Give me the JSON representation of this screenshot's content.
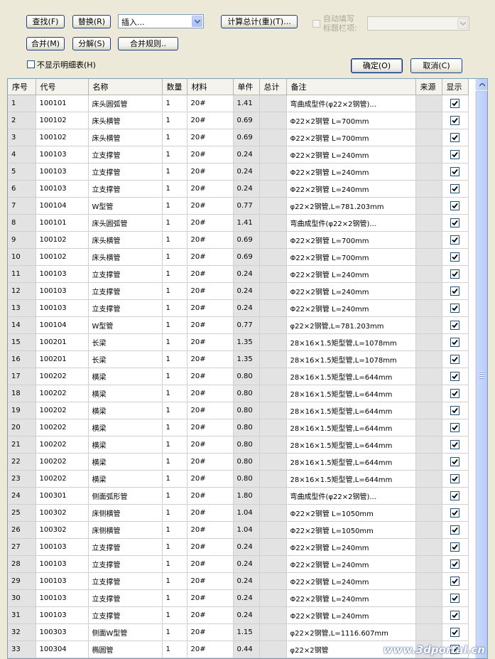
{
  "toolbar": {
    "find_label": "查找(F)",
    "replace_label": "替换(R)",
    "insert_value": "插入...",
    "calc_total_label": "计算总计(重)(T)...",
    "fill_title_label_line1": "自动填写",
    "fill_title_label_line2": "标题栏项:",
    "merge_label": "合并(M)",
    "split_label": "分解(S)",
    "merge_rules_label": "合并规则..",
    "hide_detail_label": "不显示明细表(H)",
    "ok_label": "确定(O)",
    "cancel_label": "取消(C)"
  },
  "table": {
    "headers": [
      "序号",
      "代号",
      "名称",
      "数量",
      "材料",
      "单件",
      "总计",
      "备注",
      "来源",
      "显示"
    ],
    "rows": [
      [
        "1",
        "100101",
        "床头圆弧管",
        "1",
        "20#",
        "1.41",
        "",
        "弯曲成型件(φ22×2钢管)...",
        "",
        true
      ],
      [
        "2",
        "100102",
        "床头横管",
        "1",
        "20#",
        "0.69",
        "",
        "Φ22×2钢管 L=700mm",
        "",
        true
      ],
      [
        "3",
        "100102",
        "床头横管",
        "1",
        "20#",
        "0.69",
        "",
        "Φ22×2钢管 L=700mm",
        "",
        true
      ],
      [
        "4",
        "100103",
        "立支撑管",
        "1",
        "20#",
        "0.24",
        "",
        "Φ22×2钢管 L=240mm",
        "",
        true
      ],
      [
        "5",
        "100103",
        "立支撑管",
        "1",
        "20#",
        "0.24",
        "",
        "Φ22×2钢管 L=240mm",
        "",
        true
      ],
      [
        "6",
        "100103",
        "立支撑管",
        "1",
        "20#",
        "0.24",
        "",
        "Φ22×2钢管 L=240mm",
        "",
        true
      ],
      [
        "7",
        "100104",
        "W型管",
        "1",
        "20#",
        "0.77",
        "",
        "φ22×2钢管,L=781.203mm",
        "",
        true
      ],
      [
        "8",
        "100101",
        "床头圆弧管",
        "1",
        "20#",
        "1.41",
        "",
        "弯曲成型件(φ22×2钢管)...",
        "",
        true
      ],
      [
        "9",
        "100102",
        "床头横管",
        "1",
        "20#",
        "0.69",
        "",
        "Φ22×2钢管 L=700mm",
        "",
        true
      ],
      [
        "10",
        "100102",
        "床头横管",
        "1",
        "20#",
        "0.69",
        "",
        "Φ22×2钢管 L=700mm",
        "",
        true
      ],
      [
        "11",
        "100103",
        "立支撑管",
        "1",
        "20#",
        "0.24",
        "",
        "Φ22×2钢管 L=240mm",
        "",
        true
      ],
      [
        "12",
        "100103",
        "立支撑管",
        "1",
        "20#",
        "0.24",
        "",
        "Φ22×2钢管 L=240mm",
        "",
        true
      ],
      [
        "13",
        "100103",
        "立支撑管",
        "1",
        "20#",
        "0.24",
        "",
        "Φ22×2钢管 L=240mm",
        "",
        true
      ],
      [
        "14",
        "100104",
        "W型管",
        "1",
        "20#",
        "0.77",
        "",
        "φ22×2钢管,L=781.203mm",
        "",
        true
      ],
      [
        "15",
        "100201",
        "长梁",
        "1",
        "20#",
        "1.35",
        "",
        "28×16×1.5矩型管,L=1078mm",
        "",
        true
      ],
      [
        "16",
        "100201",
        "长梁",
        "1",
        "20#",
        "1.35",
        "",
        "28×16×1.5矩型管,L=1078mm",
        "",
        true
      ],
      [
        "17",
        "100202",
        "横梁",
        "1",
        "20#",
        "0.80",
        "",
        "28×16×1.5矩型管,L=644mm",
        "",
        true
      ],
      [
        "18",
        "100202",
        "横梁",
        "1",
        "20#",
        "0.80",
        "",
        "28×16×1.5矩型管,L=644mm",
        "",
        true
      ],
      [
        "19",
        "100202",
        "横梁",
        "1",
        "20#",
        "0.80",
        "",
        "28×16×1.5矩型管,L=644mm",
        "",
        true
      ],
      [
        "20",
        "100202",
        "横梁",
        "1",
        "20#",
        "0.80",
        "",
        "28×16×1.5矩型管,L=644mm",
        "",
        true
      ],
      [
        "21",
        "100202",
        "横梁",
        "1",
        "20#",
        "0.80",
        "",
        "28×16×1.5矩型管,L=644mm",
        "",
        true
      ],
      [
        "22",
        "100202",
        "横梁",
        "1",
        "20#",
        "0.80",
        "",
        "28×16×1.5矩型管,L=644mm",
        "",
        true
      ],
      [
        "23",
        "100202",
        "横梁",
        "1",
        "20#",
        "0.80",
        "",
        "28×16×1.5矩型管,L=644mm",
        "",
        true
      ],
      [
        "24",
        "100301",
        "侧面弧形管",
        "1",
        "20#",
        "1.80",
        "",
        "弯曲成型件(φ22×2钢管)...",
        "",
        true
      ],
      [
        "25",
        "100302",
        "床侧横管",
        "1",
        "20#",
        "1.04",
        "",
        "Φ22×2钢管 L=1050mm",
        "",
        true
      ],
      [
        "26",
        "100302",
        "床侧横管",
        "1",
        "20#",
        "1.04",
        "",
        "Φ22×2钢管 L=1050mm",
        "",
        true
      ],
      [
        "27",
        "100103",
        "立支撑管",
        "1",
        "20#",
        "0.24",
        "",
        "Φ22×2钢管 L=240mm",
        "",
        true
      ],
      [
        "28",
        "100103",
        "立支撑管",
        "1",
        "20#",
        "0.24",
        "",
        "Φ22×2钢管 L=240mm",
        "",
        true
      ],
      [
        "29",
        "100103",
        "立支撑管",
        "1",
        "20#",
        "0.24",
        "",
        "Φ22×2钢管 L=240mm",
        "",
        true
      ],
      [
        "30",
        "100103",
        "立支撑管",
        "1",
        "20#",
        "0.24",
        "",
        "Φ22×2钢管 L=240mm",
        "",
        true
      ],
      [
        "31",
        "100103",
        "立支撑管",
        "1",
        "20#",
        "0.24",
        "",
        "Φ22×2钢管 L=240mm",
        "",
        true
      ],
      [
        "32",
        "100303",
        "侧面W型管",
        "1",
        "20#",
        "1.15",
        "",
        "φ22×2钢管,L=1116.607mm",
        "",
        true
      ],
      [
        "33",
        "100304",
        "椭圆管",
        "1",
        "20#",
        "0.44",
        "",
        "φ22×2钢管",
        "",
        true
      ]
    ]
  },
  "watermark": "www.3dportal.cn",
  "colors": {
    "dialog_bg": "#ECE9D8",
    "button_border": "#1C3F86",
    "grid_border": "#7F9DB9",
    "shaded_cell": "#E3E3E3",
    "scrollbar_blue": "#B5C9F7"
  }
}
